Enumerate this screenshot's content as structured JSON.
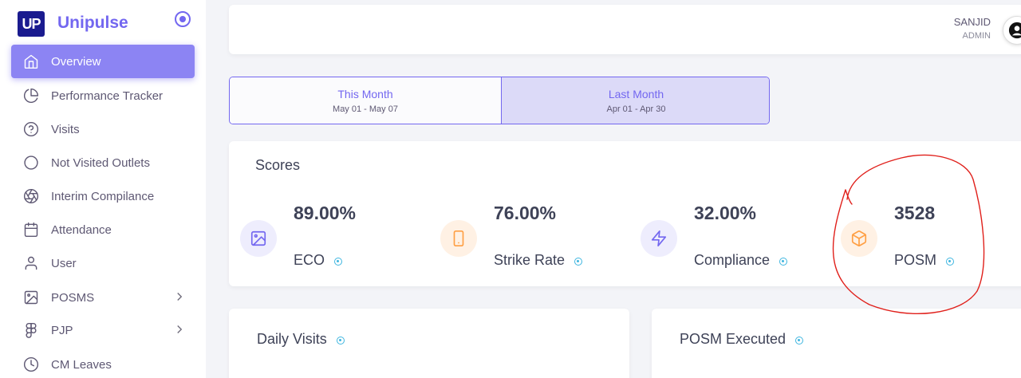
{
  "brand": {
    "logo_text": "UP",
    "name": "Unipulse"
  },
  "sidebar": {
    "items": [
      {
        "label": "Overview",
        "icon": "home-icon",
        "active": true
      },
      {
        "label": "Performance Tracker",
        "icon": "pie-chart-icon"
      },
      {
        "label": "Visits",
        "icon": "help-circle-icon"
      },
      {
        "label": "Not Visited Outlets",
        "icon": "circle-icon"
      },
      {
        "label": "Interim Compilance",
        "icon": "aperture-icon"
      },
      {
        "label": "Attendance",
        "icon": "calendar-icon"
      },
      {
        "label": "User",
        "icon": "user-icon"
      },
      {
        "label": "POSMS",
        "icon": "image-icon",
        "has_submenu": true
      },
      {
        "label": "PJP",
        "icon": "figma-icon",
        "has_submenu": true
      },
      {
        "label": "CM Leaves",
        "icon": "clock-icon"
      }
    ]
  },
  "header": {
    "user_name": "SANJID",
    "user_role": "ADMIN"
  },
  "periods": [
    {
      "title": "This Month",
      "range": "May 01 - May 07",
      "selected": false
    },
    {
      "title": "Last Month",
      "range": "Apr 01 - Apr 30",
      "selected": true
    }
  ],
  "scores": {
    "title": "Scores",
    "items": [
      {
        "value": "89.00%",
        "label": "ECO",
        "icon": "image-icon",
        "color": "#7367f0",
        "bg": "#eeedfd"
      },
      {
        "value": "76.00%",
        "label": "Strike Rate",
        "icon": "tablet-icon",
        "color": "#ff9f43",
        "bg": "#fff1e4"
      },
      {
        "value": "32.00%",
        "label": "Compliance",
        "icon": "zap-icon",
        "color": "#7367f0",
        "bg": "#eeedfd"
      },
      {
        "value": "3528",
        "label": "POSM",
        "icon": "box-icon",
        "color": "#ff9f43",
        "bg": "#fff1e4"
      }
    ]
  },
  "cards": {
    "daily_visits": "Daily Visits",
    "posm_executed": "POSM Executed"
  },
  "colors": {
    "accent": "#7367f0",
    "annotation": "#e0201b"
  }
}
